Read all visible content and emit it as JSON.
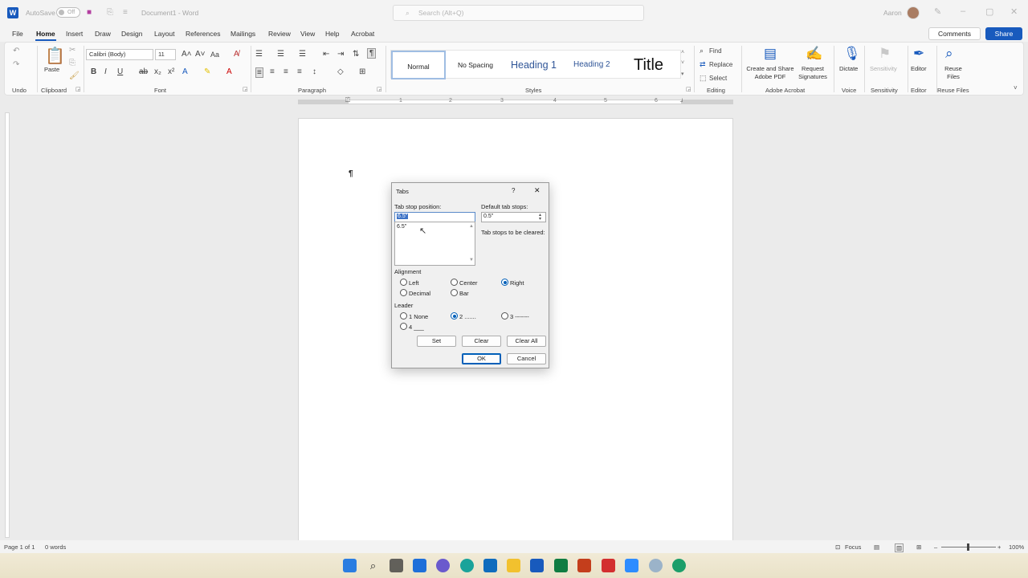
{
  "titlebar": {
    "autosave_label": "AutoSave",
    "autosave_state": "Off",
    "doc_title": "Document1 - Word",
    "search_placeholder": "Search (Alt+Q)",
    "user": "Aaron"
  },
  "menu": {
    "items": [
      "File",
      "Home",
      "Insert",
      "Draw",
      "Design",
      "Layout",
      "References",
      "Mailings",
      "Review",
      "View",
      "Help",
      "Acrobat"
    ],
    "active": "Home",
    "comments": "Comments",
    "share": "Share"
  },
  "ribbon": {
    "undo_group": "Undo",
    "clipboard": {
      "paste": "Paste",
      "label": "Clipboard"
    },
    "font": {
      "name": "Calibri (Body)",
      "size": "11",
      "label": "Font",
      "case_btn": "Aa"
    },
    "paragraph": {
      "label": "Paragraph"
    },
    "styles": {
      "items": [
        "Normal",
        "No Spacing",
        "Heading 1",
        "Heading 2",
        "Title"
      ],
      "label": "Styles"
    },
    "editing": {
      "find": "Find",
      "replace": "Replace",
      "select": "Select",
      "label": "Editing"
    },
    "acrobat": {
      "create": "Create and Share Adobe PDF",
      "request": "Request Signatures",
      "label": "Adobe Acrobat"
    },
    "voice": {
      "dictate": "Dictate",
      "label": "Voice"
    },
    "sensitivity": {
      "btn": "Sensitivity",
      "label": "Sensitivity"
    },
    "editor": {
      "btn": "Editor",
      "label": "Editor"
    },
    "reuse": {
      "btn": "Reuse Files",
      "label": "Reuse Files"
    }
  },
  "ruler_numbers": [
    "1",
    "2",
    "3",
    "4",
    "5",
    "6"
  ],
  "document": {
    "pilcrow": "¶"
  },
  "dialog": {
    "title": "Tabs",
    "help": "?",
    "close": "✕",
    "tab_stop_label": "Tab stop position:",
    "tab_stop_value": "6.5\"",
    "tab_list": [
      "6.5\""
    ],
    "default_label": "Default tab stops:",
    "default_value": "0.5\"",
    "cleared_label": "Tab stops to be cleared:",
    "alignment_label": "Alignment",
    "alignment": [
      "Left",
      "Center",
      "Right",
      "Decimal",
      "Bar"
    ],
    "alignment_selected": "Right",
    "leader_label": "Leader",
    "leader": [
      "1 None",
      "2 .......",
      "3 -------",
      "4 ___"
    ],
    "leader_selected": "2 .......",
    "set": "Set",
    "clear": "Clear",
    "clear_all": "Clear All",
    "ok": "OK",
    "cancel": "Cancel"
  },
  "statusbar": {
    "page": "Page 1 of 1",
    "words": "0 words",
    "focus": "Focus",
    "zoom": "100%"
  }
}
